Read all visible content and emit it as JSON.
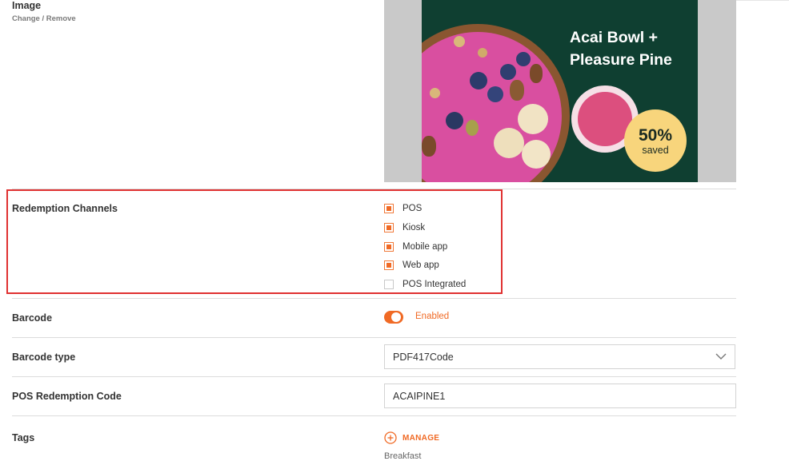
{
  "image_section": {
    "label": "Image",
    "actions": "Change / Remove",
    "promo": {
      "title_line1": "Acai Bowl +",
      "title_line2": "Pleasure Pine",
      "badge_percent": "50%",
      "badge_text": "saved"
    }
  },
  "redemption": {
    "label": "Redemption Channels",
    "options": [
      {
        "label": "POS",
        "checked": true
      },
      {
        "label": "Kiosk",
        "checked": true
      },
      {
        "label": "Mobile app",
        "checked": true
      },
      {
        "label": "Web app",
        "checked": true
      },
      {
        "label": "POS Integrated",
        "checked": false
      }
    ]
  },
  "barcode": {
    "label": "Barcode",
    "status": "Enabled",
    "enabled": true
  },
  "barcode_type": {
    "label": "Barcode type",
    "value": "PDF417Code"
  },
  "pos_code": {
    "label": "POS Redemption Code",
    "value": "ACAIPINE1"
  },
  "tags": {
    "label": "Tags",
    "manage": "MANAGE",
    "first_tag": "Breakfast"
  },
  "colors": {
    "accent": "#f06a25",
    "highlight": "#e03131",
    "promo_bg": "#0f3f31",
    "badge": "#f8d57c"
  }
}
